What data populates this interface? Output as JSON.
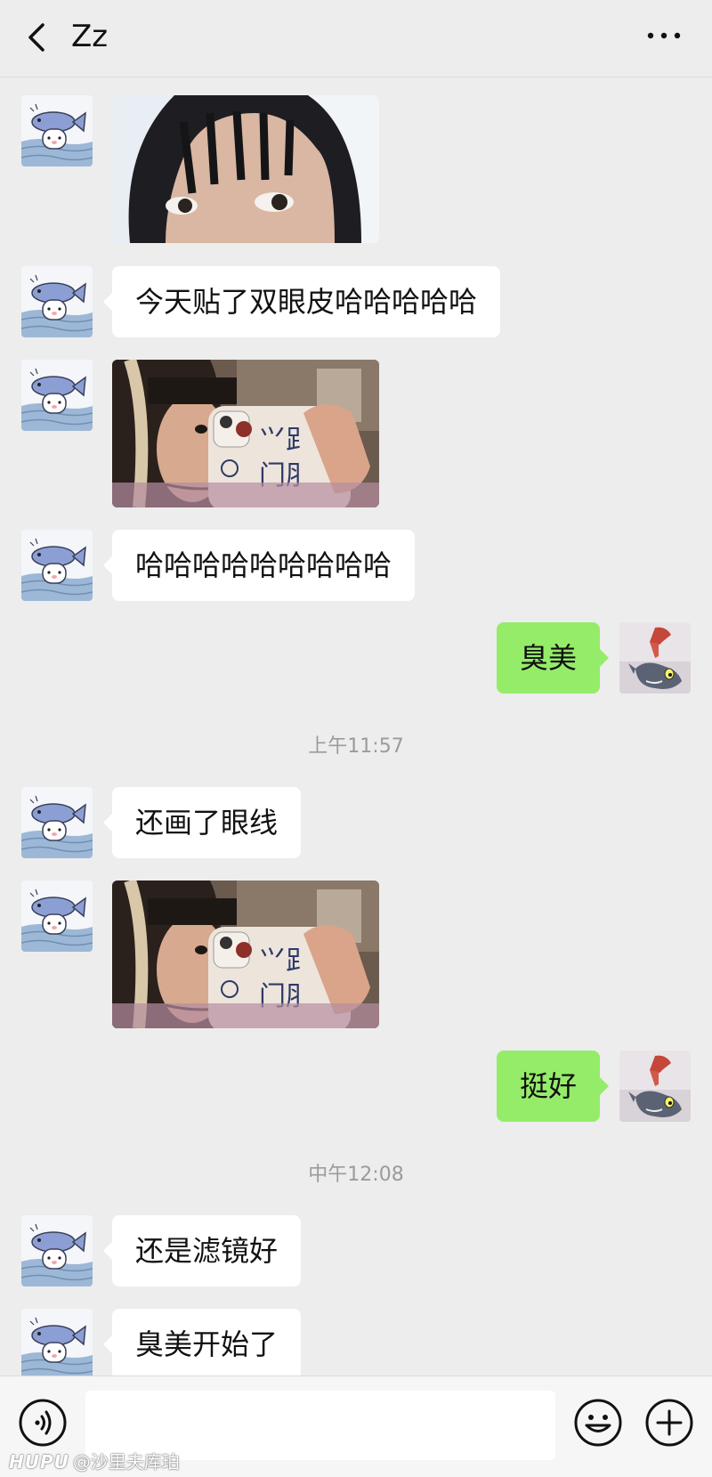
{
  "header": {
    "title": "Zz",
    "back_icon": "chevron-left-icon",
    "more_icon": "more-horizontal-icon"
  },
  "colors": {
    "background": "#EDEDED",
    "incoming_bubble": "#FFFFFF",
    "outgoing_bubble": "#95EC69",
    "timestamp_text": "#9B9B9B"
  },
  "messages": [
    {
      "direction": "in",
      "type": "image",
      "description_icon": "photo"
    },
    {
      "direction": "in",
      "type": "text",
      "text": "今天贴了双眼皮哈哈哈哈哈"
    },
    {
      "direction": "in",
      "type": "image",
      "description_icon": "photo"
    },
    {
      "direction": "in",
      "type": "text",
      "text": "哈哈哈哈哈哈哈哈哈"
    },
    {
      "direction": "out",
      "type": "text",
      "text": "臭美"
    },
    {
      "type": "timestamp",
      "text": "上午11:57"
    },
    {
      "direction": "in",
      "type": "text",
      "text": "还画了眼线"
    },
    {
      "direction": "in",
      "type": "image",
      "description_icon": "photo"
    },
    {
      "direction": "out",
      "type": "text",
      "text": "挺好"
    },
    {
      "type": "timestamp",
      "text": "中午12:08"
    },
    {
      "direction": "in",
      "type": "text",
      "text": "还是滤镜好"
    },
    {
      "direction": "in",
      "type": "text",
      "text": "臭美开始了"
    }
  ],
  "input_bar": {
    "voice_icon": "voice-icon",
    "input_value": "",
    "emoji_icon": "emoji-icon",
    "plus_icon": "plus-icon"
  },
  "watermark": {
    "brand": "HUPU",
    "handle": "@沙里夫库珀"
  }
}
